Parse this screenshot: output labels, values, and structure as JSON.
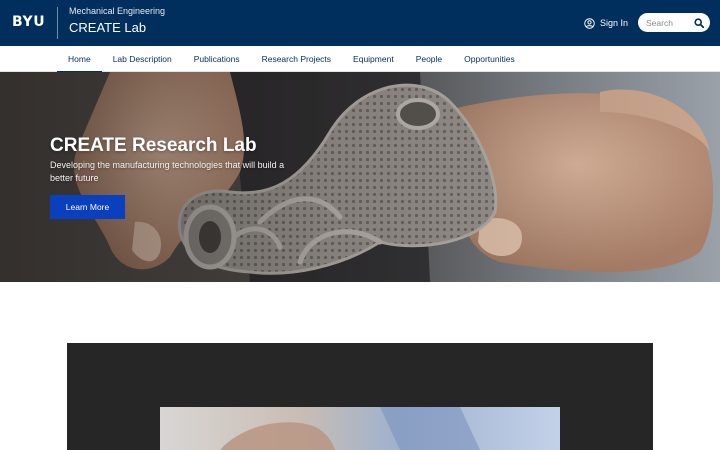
{
  "header": {
    "logo_text": "BYU",
    "parent_site": "Mechanical Engineering",
    "site_title": "CREATE Lab",
    "signin_label": "Sign In",
    "signin_icon": "user-circle-icon",
    "search": {
      "placeholder": "Search",
      "value": "",
      "icon": "search-icon"
    }
  },
  "nav": {
    "items": [
      {
        "label": "Home",
        "active": true
      },
      {
        "label": "Lab Description",
        "active": false
      },
      {
        "label": "Publications",
        "active": false
      },
      {
        "label": "Research Projects",
        "active": false
      },
      {
        "label": "Equipment",
        "active": false
      },
      {
        "label": "People",
        "active": false
      },
      {
        "label": "Opportunities",
        "active": false
      }
    ]
  },
  "hero": {
    "title": "CREATE Research Lab",
    "subtitle": "Developing the manufacturing technologies that will build a better future",
    "button_label": "Learn More"
  },
  "colors": {
    "brand_navy": "#002e5d",
    "button_blue": "#0a3fbd",
    "video_panel": "#262626"
  }
}
